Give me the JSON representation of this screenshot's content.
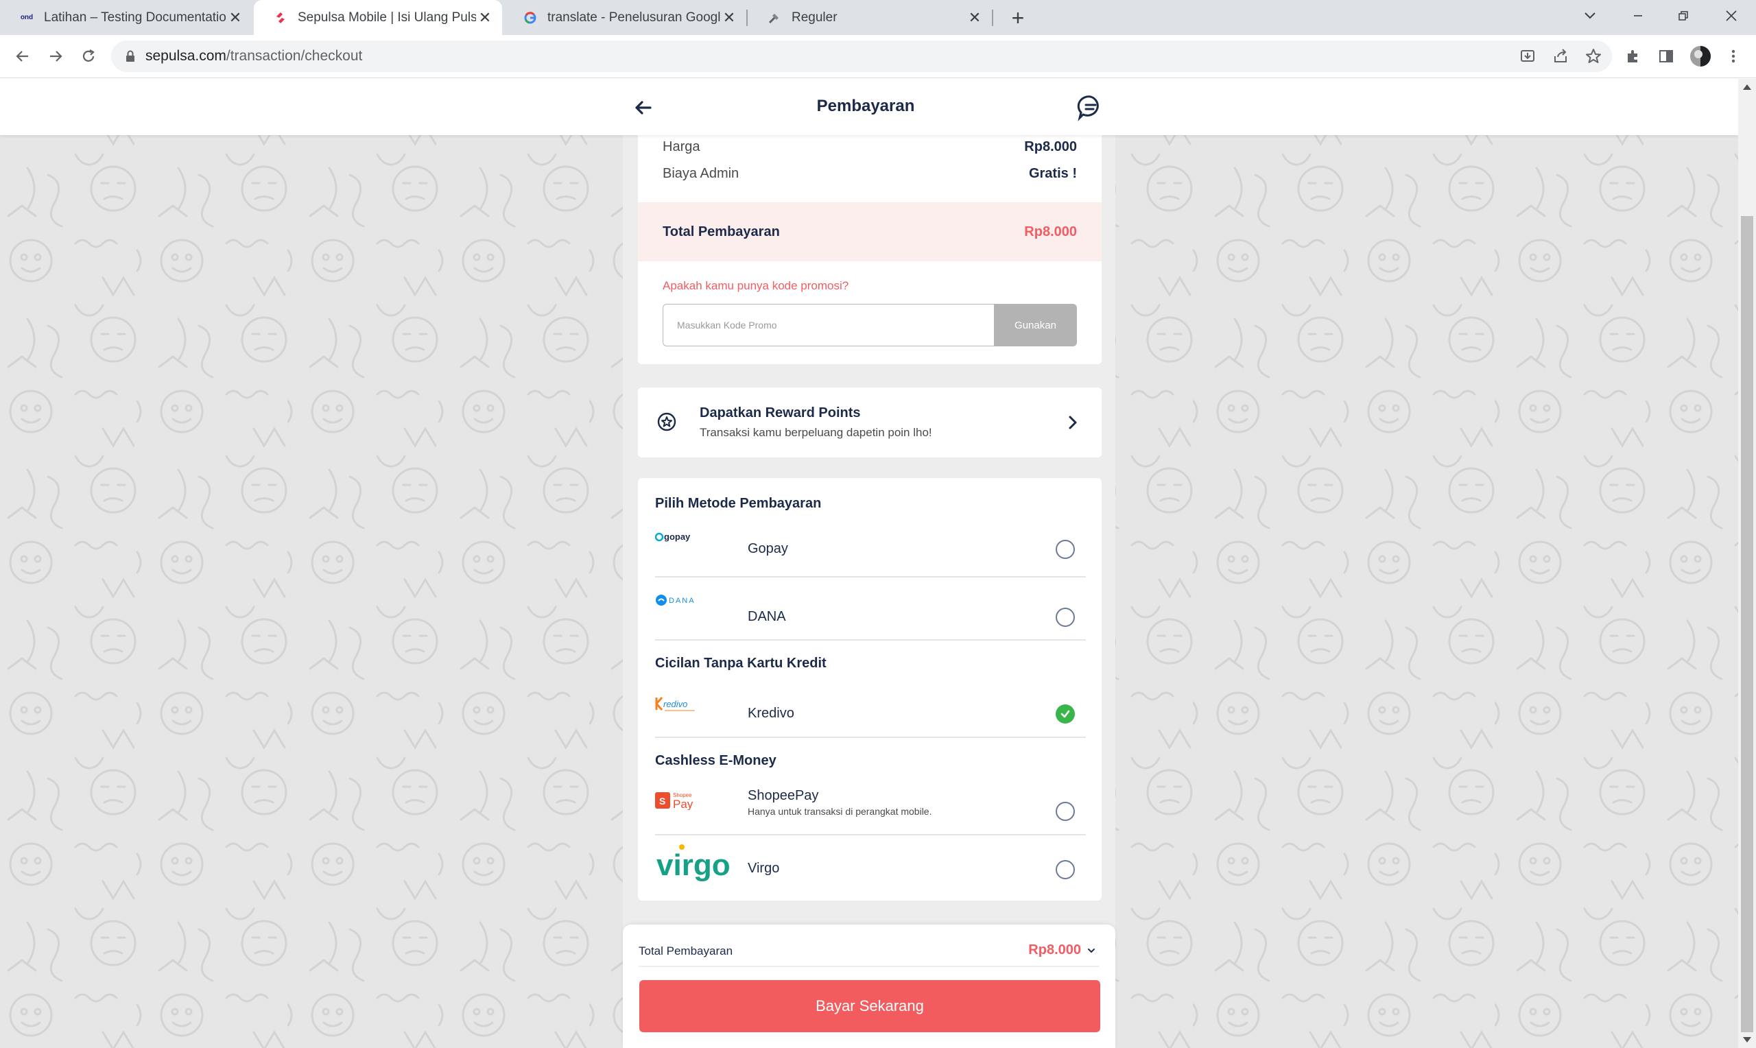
{
  "browser": {
    "tabs": [
      {
        "title": "Latihan – Testing Documentation",
        "favicon": "ond-logo-icon",
        "active": false
      },
      {
        "title": "Sepulsa Mobile | Isi Ulang Pulsa S",
        "favicon": "sepulsa-logo-icon",
        "active": true
      },
      {
        "title": "translate - Penelusuran Google",
        "favicon": "google-logo-icon",
        "active": false
      },
      {
        "title": "Reguler",
        "favicon": "tool-icon",
        "active": false
      }
    ],
    "url_host": "sepulsa.com",
    "url_path": "/transaction/checkout"
  },
  "header": {
    "title": "Pembayaran"
  },
  "summary": {
    "price_label": "Harga",
    "price_value": "Rp8.000",
    "admin_label": "Biaya Admin",
    "admin_value": "Gratis !",
    "total_label": "Total Pembayaran",
    "total_value": "Rp8.000"
  },
  "promo": {
    "question": "Apakah kamu punya kode promosi?",
    "placeholder": "Masukkan Kode Promo",
    "button_label": "Gunakan"
  },
  "reward": {
    "title": "Dapatkan Reward Points",
    "subtitle": "Transaksi kamu berpeluang dapetin poin lho!"
  },
  "payment": {
    "sections": [
      {
        "title": "Pilih Metode Pembayaran",
        "methods": [
          {
            "name": "Gopay",
            "logo_text": "gopay",
            "selected": false
          },
          {
            "name": "DANA",
            "logo_text": "DANA",
            "selected": false
          }
        ]
      },
      {
        "title": "Cicilan Tanpa Kartu Kredit",
        "methods": [
          {
            "name": "Kredivo",
            "logo_text": "Kredivo",
            "selected": true
          }
        ]
      },
      {
        "title": "Cashless E-Money",
        "methods": [
          {
            "name": "ShopeePay",
            "note": "Hanya untuk transaksi di perangkat mobile.",
            "logo_text": "Pay",
            "selected": false
          },
          {
            "name": "Virgo",
            "logo_text": "virgo",
            "selected": false
          }
        ]
      }
    ]
  },
  "footer": {
    "total_label": "Total Pembayaran",
    "total_value": "Rp8.000",
    "pay_button": "Bayar Sekarang"
  },
  "colors": {
    "accent_red": "#f25c5f",
    "navy": "#1c2a4a",
    "selected_green": "#3ab54a"
  }
}
